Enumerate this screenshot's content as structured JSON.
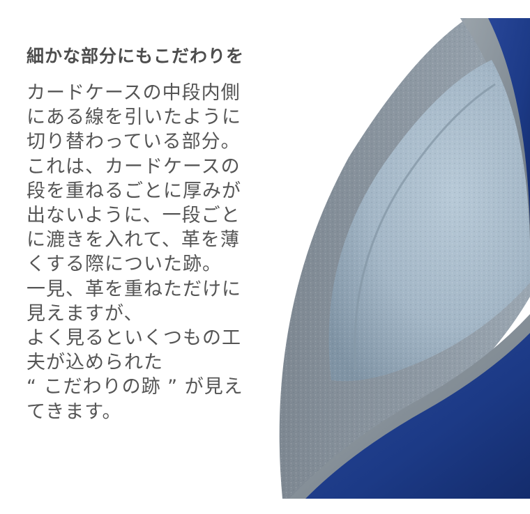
{
  "heading": "細かな部分にもこだわりを",
  "body_lines": [
    "カードケースの中段内側",
    "にある線を引いたように",
    "切り替わっている部分。",
    "これは、カードケースの",
    "段を重ねるごとに厚みが",
    "出ないように、一段ごと",
    "に漉きを入れて、革を薄",
    "くする際についた跡。",
    "一見、革を重ねただけに",
    "見えますが、",
    "よく見るといくつもの工",
    "夫が込められた",
    "“ こだわりの跡 ” が見え",
    "てきます。"
  ],
  "photo": {
    "subject": "leather-card-case-interior",
    "colors": {
      "suede": "#a9bccb",
      "leather_edge": "#8c969e",
      "blue_leather": "#1f3f8f"
    }
  }
}
